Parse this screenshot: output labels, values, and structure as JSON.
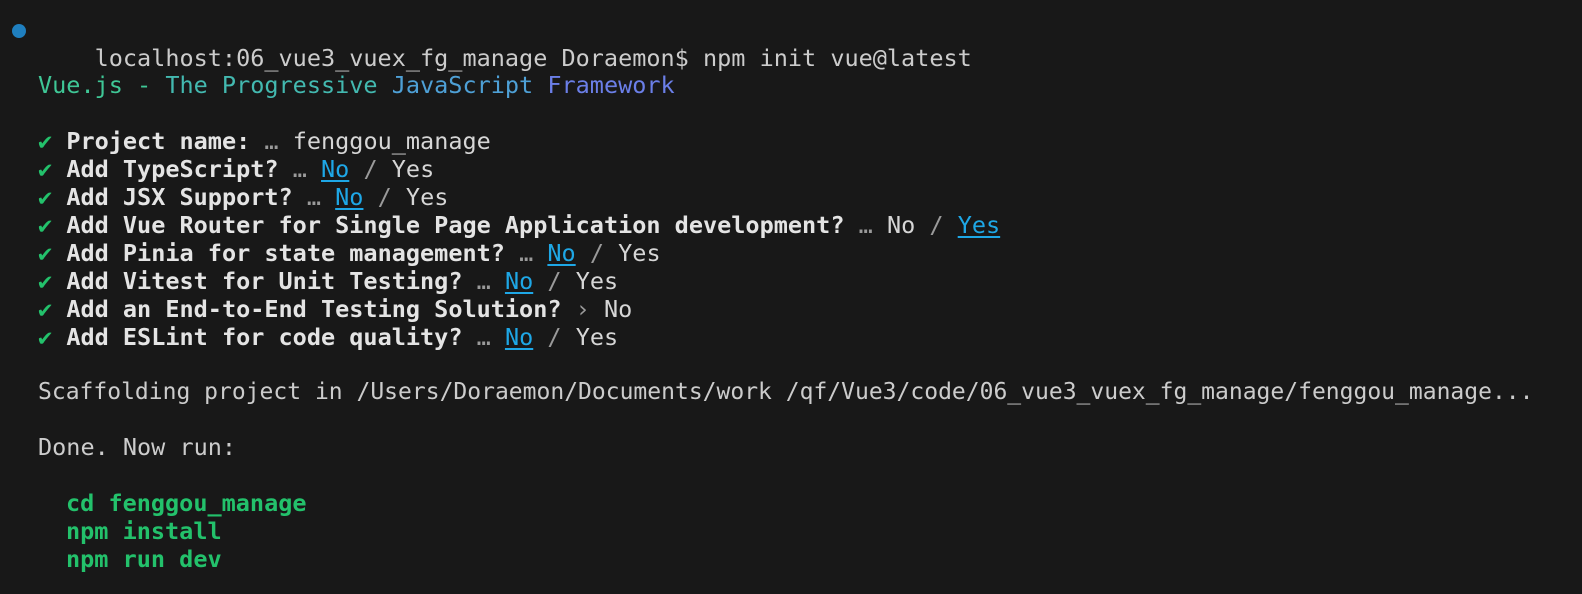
{
  "prompt": {
    "host_path": "localhost:06_vue3_vuex_fg_manage Doraemon$",
    "command": "npm init vue@latest"
  },
  "banner": {
    "part1": "Vue.js - ",
    "part2": "The Progressive ",
    "part3": "JavaScript ",
    "part4": "Framework"
  },
  "questions": [
    {
      "check": "✔",
      "label": "Project name:",
      "sep": "…",
      "answer": "fenggou_manage"
    },
    {
      "check": "✔",
      "label": "Add TypeScript?",
      "sep": "…",
      "no": "No",
      "slash": "/",
      "yes": "Yes",
      "selected": "no"
    },
    {
      "check": "✔",
      "label": "Add JSX Support?",
      "sep": "…",
      "no": "No",
      "slash": "/",
      "yes": "Yes",
      "selected": "no"
    },
    {
      "check": "✔",
      "label": "Add Vue Router for Single Page Application development?",
      "sep": "…",
      "no": "No",
      "slash": "/",
      "yes": "Yes",
      "selected": "yes"
    },
    {
      "check": "✔",
      "label": "Add Pinia for state management?",
      "sep": "…",
      "no": "No",
      "slash": "/",
      "yes": "Yes",
      "selected": "no"
    },
    {
      "check": "✔",
      "label": "Add Vitest for Unit Testing?",
      "sep": "…",
      "no": "No",
      "slash": "/",
      "yes": "Yes",
      "selected": "no"
    },
    {
      "check": "✔",
      "label": "Add an End-to-End Testing Solution?",
      "sep": "›",
      "answer": "No"
    },
    {
      "check": "✔",
      "label": "Add ESLint for code quality?",
      "sep": "…",
      "no": "No",
      "slash": "/",
      "yes": "Yes",
      "selected": "no"
    }
  ],
  "scaffolding": "Scaffolding project in /Users/Doraemon/Documents/work /qf/Vue3/code/06_vue3_vuex_fg_manage/fenggou_manage...",
  "done": "Done. Now run:",
  "commands": [
    "cd fenggou_manage",
    "npm install",
    "npm run dev"
  ],
  "colors": {
    "background": "#181818",
    "check": "#23c16b",
    "selected": "#1ea7e6",
    "status_dot": "#1f7fbf"
  }
}
